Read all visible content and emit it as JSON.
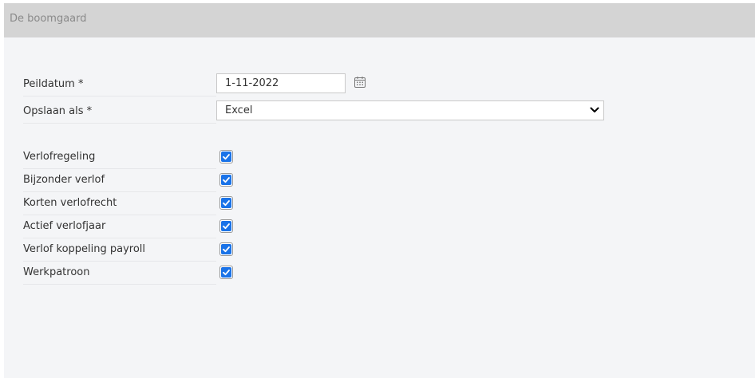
{
  "header": {
    "title": "De boomgaard"
  },
  "form": {
    "peildatum": {
      "label": "Peildatum *",
      "value": "1-11-2022"
    },
    "opslaan_als": {
      "label": "Opslaan als *",
      "selected": "Excel"
    },
    "options": [
      {
        "label": "Verlofregeling",
        "checked": true
      },
      {
        "label": "Bijzonder verlof",
        "checked": true
      },
      {
        "label": "Korten verlofrecht",
        "checked": true
      },
      {
        "label": "Actief verlofjaar",
        "checked": true
      },
      {
        "label": "Verlof koppeling payroll",
        "checked": true
      },
      {
        "label": "Werkpatroon",
        "checked": true
      }
    ]
  },
  "colors": {
    "header_bg": "#d4d4d4",
    "panel_bg": "#f4f5f7",
    "checkbox_accent": "#1a73e8"
  },
  "icons": {
    "date_picker": "calendar-icon",
    "select": "chevron-down-icon",
    "checkbox": "checkmark-icon"
  }
}
